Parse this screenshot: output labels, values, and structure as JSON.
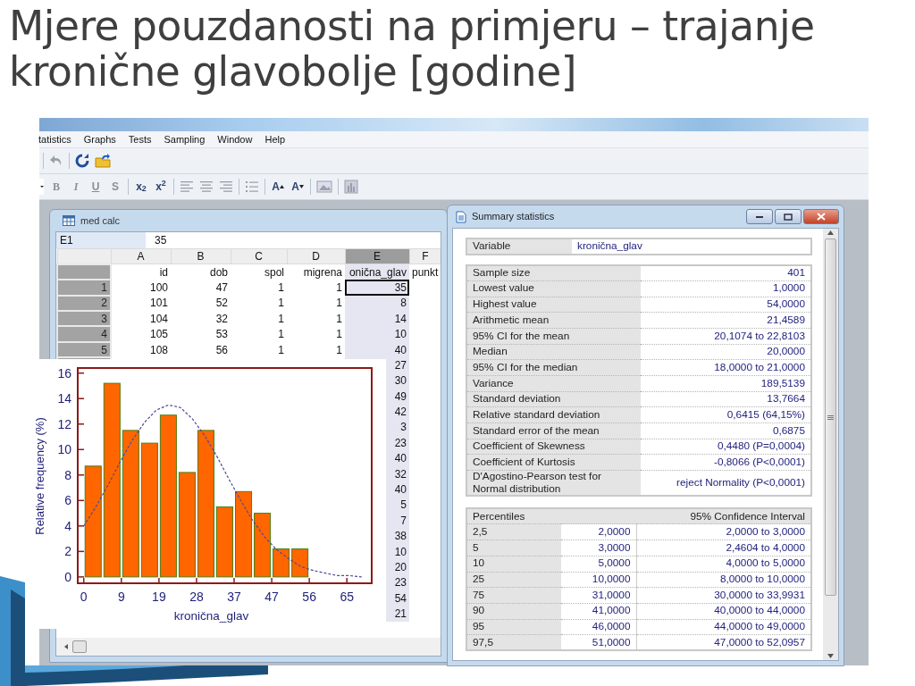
{
  "slide_title": "Mjere pouzdanosti na primjeru – trajanje kronične glavobolje [godine]",
  "app": {
    "menu": [
      {
        "label": "tatistics"
      },
      {
        "label": "Graphs"
      },
      {
        "label": "Tests"
      },
      {
        "label": "Sampling"
      },
      {
        "label": "Window"
      },
      {
        "label": "Help"
      }
    ],
    "toolbar": [
      {
        "kind": "undo",
        "disabled": true
      },
      {
        "kind": "redo"
      },
      {
        "kind": "open"
      }
    ],
    "format_toolbar": [
      {
        "kind": "combo"
      },
      {
        "kind": "bold",
        "label": "B",
        "disabled": true
      },
      {
        "kind": "italic",
        "label": "I",
        "disabled": true
      },
      {
        "kind": "underline",
        "label": "U",
        "disabled": true
      },
      {
        "kind": "strike",
        "label": "S",
        "disabled": true
      },
      {
        "kind": "sep"
      },
      {
        "kind": "script",
        "label": "x$_{2}$",
        "disabled": false
      },
      {
        "kind": "script",
        "label": "x$^{2}$",
        "disabled": false
      },
      {
        "kind": "sep"
      },
      {
        "kind": "align-left",
        "disabled": true
      },
      {
        "kind": "align-center",
        "disabled": true
      },
      {
        "kind": "align-right",
        "disabled": true
      },
      {
        "kind": "sep"
      },
      {
        "kind": "list",
        "disabled": true
      },
      {
        "kind": "sep"
      },
      {
        "kind": "grow",
        "label": "A",
        "disabled": false
      },
      {
        "kind": "shrink",
        "label": "A",
        "disabled": false
      },
      {
        "kind": "sep"
      },
      {
        "kind": "image",
        "disabled": true
      },
      {
        "kind": "sep"
      },
      {
        "kind": "chart",
        "disabled": true
      }
    ]
  },
  "spreadsheet": {
    "title": "med calc",
    "cell_ref": "E1",
    "cell_value": "35",
    "columns": [
      {
        "letter": "A",
        "name": "id",
        "selected": false
      },
      {
        "letter": "B",
        "name": "dob",
        "selected": false
      },
      {
        "letter": "C",
        "name": "spol",
        "selected": false
      },
      {
        "letter": "D",
        "name": "migrena",
        "selected": false
      },
      {
        "letter": "E",
        "name": "onična_glav",
        "selected": true
      },
      {
        "letter": "F",
        "name": "punkt",
        "selected": false
      }
    ],
    "rows": [
      {
        "number": "1",
        "active": true,
        "cells": [
          "100",
          "47",
          "1",
          "1",
          "35"
        ]
      },
      {
        "number": "2",
        "active": false,
        "cells": [
          "101",
          "52",
          "1",
          "1",
          "8"
        ]
      },
      {
        "number": "3",
        "active": false,
        "cells": [
          "104",
          "32",
          "1",
          "1",
          "14"
        ]
      },
      {
        "number": "4",
        "active": false,
        "cells": [
          "105",
          "53",
          "1",
          "1",
          "10"
        ]
      },
      {
        "number": "5",
        "active": false,
        "cells": [
          "108",
          "56",
          "1",
          "1",
          "40"
        ]
      },
      {
        "active": false,
        "cells": [
          "27"
        ]
      },
      {
        "active": false,
        "cells": [
          "30"
        ]
      },
      {
        "active": false,
        "cells": [
          "49"
        ]
      },
      {
        "active": false,
        "cells": [
          "42"
        ]
      },
      {
        "active": false,
        "cells": [
          "3"
        ]
      },
      {
        "active": false,
        "cells": [
          "23"
        ]
      },
      {
        "active": false,
        "cells": [
          "40"
        ]
      },
      {
        "active": false,
        "cells": [
          "32"
        ]
      },
      {
        "active": false,
        "cells": [
          "40"
        ]
      },
      {
        "active": false,
        "cells": [
          "5"
        ]
      },
      {
        "active": false,
        "cells": [
          "7"
        ]
      },
      {
        "active": false,
        "cells": [
          "38"
        ]
      },
      {
        "active": false,
        "cells": [
          "10"
        ]
      },
      {
        "active": false,
        "cells": [
          "20"
        ]
      },
      {
        "active": false,
        "cells": [
          "23"
        ]
      },
      {
        "active": false,
        "cells": [
          "54"
        ]
      },
      {
        "active": false,
        "cells": [
          "21"
        ]
      }
    ]
  },
  "summary": {
    "title": "Summary statistics",
    "variable_label": "Variable",
    "variable_value": "kronična_glav",
    "stats": [
      {
        "label": "Sample size",
        "value": "401"
      },
      {
        "label": "Lowest value",
        "value": "1,0000"
      },
      {
        "label": "Highest value",
        "value": "54,0000"
      },
      {
        "label": "Arithmetic mean",
        "value": "21,4589"
      },
      {
        "label": "95% CI for the mean",
        "value": "20,1074 to 22,8103"
      },
      {
        "label": "Median",
        "value": "20,0000"
      },
      {
        "label": "95% CI for the median",
        "value": "18,0000 to 21,0000"
      },
      {
        "label": "Variance",
        "value": "189,5139"
      },
      {
        "label": "Standard deviation",
        "value": "13,7664"
      },
      {
        "label": "Relative standard deviation",
        "value": "0,6415 (64,15%)"
      },
      {
        "label": "Standard error of the mean",
        "value": "0,6875"
      },
      {
        "label": "Coefficient of Skewness",
        "value": "0,4480 (P=0,0004)"
      },
      {
        "label": "Coefficient of Kurtosis",
        "value": "-0,8066 (P<0,0001)"
      },
      {
        "label": "D'Agostino-Pearson test for Normal distribution",
        "value": "reject Normality (P<0,0001)"
      }
    ],
    "percentiles_header": "Percentiles",
    "ci_header": "95% Confidence Interval",
    "percentiles": [
      {
        "p": "2,5",
        "value": "2,0000",
        "ci": "2,0000 to 3,0000"
      },
      {
        "p": "5",
        "value": "3,0000",
        "ci": "2,4604 to 4,0000"
      },
      {
        "p": "10",
        "value": "5,0000",
        "ci": "4,0000 to 5,0000"
      },
      {
        "p": "25",
        "value": "10,0000",
        "ci": "8,0000 to 10,0000"
      },
      {
        "p": "75",
        "value": "31,0000",
        "ci": "30,0000 to 33,9931"
      },
      {
        "p": "90",
        "value": "41,0000",
        "ci": "40,0000 to 44,0000"
      },
      {
        "p": "95",
        "value": "46,0000",
        "ci": "44,0000 to 49,0000"
      },
      {
        "p": "97,5",
        "value": "51,0000",
        "ci": "47,0000 to 52,0957"
      }
    ]
  },
  "histogram": {
    "chart_data": {
      "type": "bar",
      "xlabel": "kronična_glav",
      "ylabel": "Relative frequency (%)",
      "x": [
        2.33,
        7,
        11.67,
        16.33,
        21,
        25.67,
        30.33,
        35,
        39.67,
        44.33,
        49,
        53.67
      ],
      "series": [
        {
          "color": "#ff6600",
          "values": [
            8.7,
            15.2,
            11.5,
            10.5,
            12.7,
            8.2,
            11.5,
            5.5,
            6.7,
            5.0,
            2.2,
            2.2
          ]
        },
        {
          "type": "line",
          "line_style": "dashed",
          "color": "#4b4b9b",
          "x": [
            0,
            3,
            6,
            9,
            12,
            15,
            18,
            21,
            24,
            27,
            30,
            33,
            36,
            39,
            42,
            45,
            48,
            51,
            54,
            57,
            60,
            63,
            66,
            69
          ],
          "values": [
            4.0,
            5.5,
            7.2,
            9.0,
            10.7,
            12.1,
            13.1,
            13.5,
            13.3,
            12.4,
            11.1,
            9.5,
            7.7,
            6.0,
            4.4,
            3.1,
            2.1,
            1.4,
            0.8,
            0.5,
            0.3,
            0.1,
            0.1,
            0.0
          ]
        }
      ],
      "xlim": [
        -1.5,
        71.5
      ],
      "ylim": [
        -0.5,
        16.4
      ],
      "xticks": [
        {
          "value": 0,
          "label": "0"
        },
        {
          "value": 9.33,
          "label": "9"
        },
        {
          "value": 18.67,
          "label": "19"
        },
        {
          "value": 28,
          "label": "28"
        },
        {
          "value": 37.33,
          "label": "37"
        },
        {
          "value": 46.67,
          "label": "47"
        },
        {
          "value": 56,
          "label": "56"
        },
        {
          "value": 65.33,
          "label": "65"
        }
      ],
      "yticks": [
        0,
        2,
        4,
        6,
        8,
        10,
        12,
        14,
        16
      ]
    }
  }
}
